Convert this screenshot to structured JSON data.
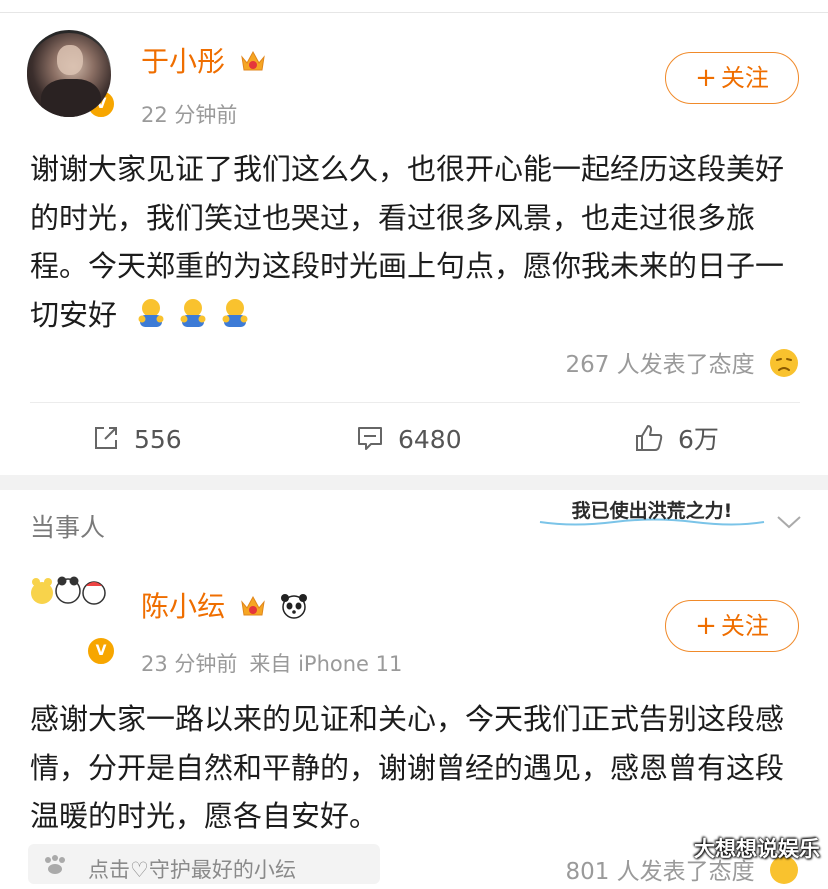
{
  "post1": {
    "username": "于小彤",
    "time": "22 分钟前",
    "follow_label": "关注",
    "text": "谢谢大家见证了我们这么久，也很开心能一起经历这段美好的时光，我们笑过也哭过，看过很多风景，也走过很多旅程。今天郑重的为这段时光画上句点，愿你我未来的日子一切安好",
    "reactions": "267 人发表了态度",
    "shares": "556",
    "comments": "6480",
    "likes": "6万"
  },
  "section": {
    "title": "当事人",
    "sticker_text": "我已使出洪荒之力!"
  },
  "post2": {
    "username": "陈小纭",
    "time": "23 分钟前",
    "source": "来自 iPhone 11",
    "follow_label": "关注",
    "text": "感谢大家一路以来的见证和关心，今天我们正式告别这段感情，分开是自然和平静的，谢谢曾经的遇见，感恩曾有这段温暖的时光，愿各自安好。",
    "tip": "点击♡守护最好的小纭",
    "reactions": "801 人发表了态度"
  },
  "watermark": "大想想说娱乐",
  "colors": {
    "accent": "#ef6e00",
    "verified": "#f7a600",
    "muted": "#9a9a9a"
  },
  "icons": [
    "crown-icon",
    "verified-icon",
    "hug-emoji",
    "sad-face-icon",
    "share-icon",
    "comment-icon",
    "like-icon",
    "chevron-down-icon",
    "panda-icon",
    "paw-icon"
  ]
}
